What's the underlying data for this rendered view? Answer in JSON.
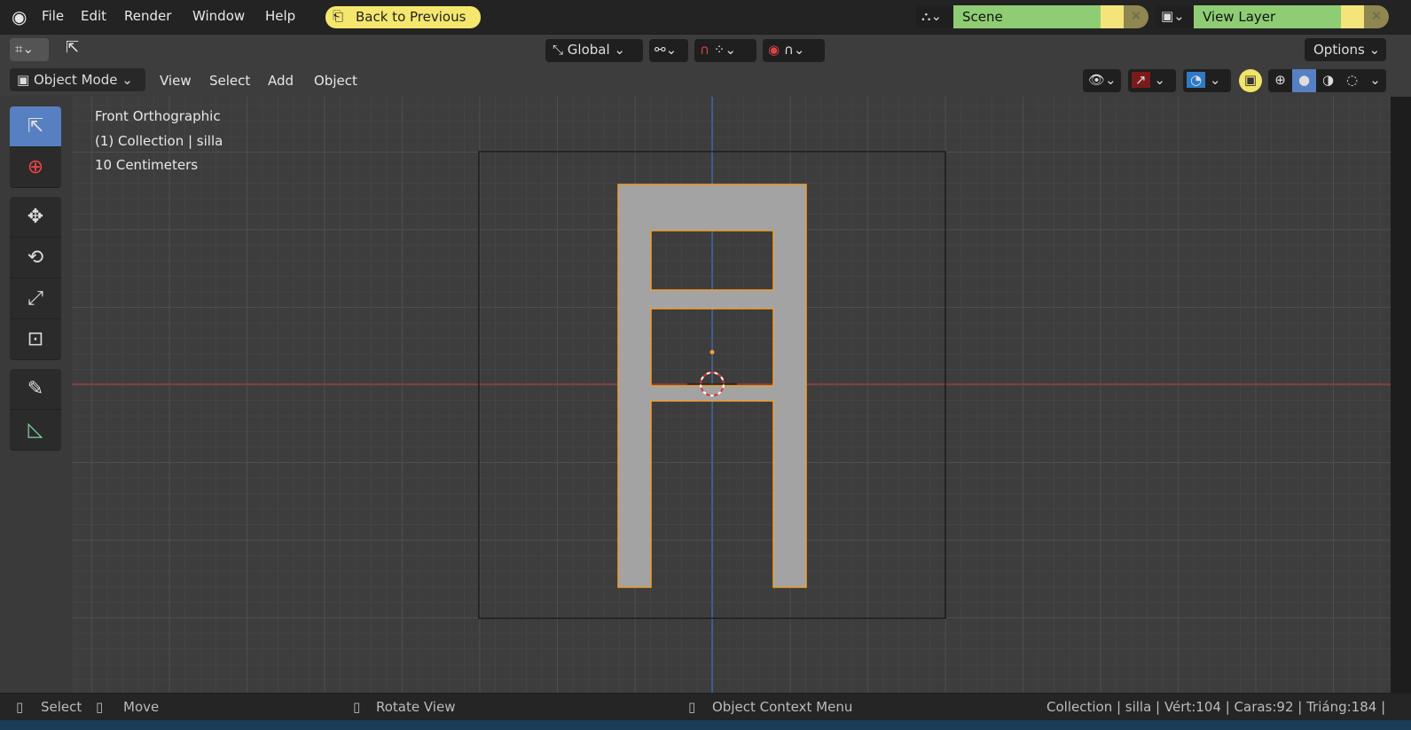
{
  "menu": [
    "File",
    "Edit",
    "Render",
    "Window",
    "Help"
  ],
  "back_label": "Back to Previous",
  "scene": "Scene",
  "view_layer": "View Layer",
  "header": {
    "orientation": "Global",
    "options": "Options",
    "mode": "Object Mode",
    "menus": [
      "View",
      "Select",
      "Add",
      "Object"
    ]
  },
  "overlay": {
    "view": "Front Orthographic",
    "collection": "(1) Collection | silla",
    "scale": "10 Centimeters"
  },
  "status": {
    "select": "Select",
    "move": "Move",
    "rotate": "Rotate View",
    "context": "Object Context Menu",
    "stats": "Collection | silla | Vért:104 | Caras:92 | Triáng:184 |"
  },
  "colors": {
    "accent": "#5680c2",
    "selection": "#f0a030",
    "x_axis": "#a33a3a",
    "y_axis": "#3c6bb0"
  }
}
